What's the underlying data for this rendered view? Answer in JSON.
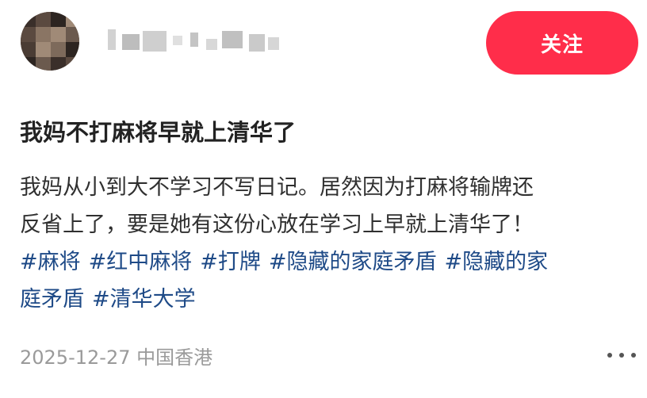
{
  "header": {
    "avatar_colors": [
      "#3a2f2a",
      "#5b4a40",
      "#8a7564",
      "#2d2521",
      "#6b5a4e",
      "#a08a77",
      "#4a3c34",
      "#7d6a5b"
    ],
    "follow_label": "关注",
    "follow_color": "#ff2d4a"
  },
  "post": {
    "title": "我妈不打麻将早就上清华了",
    "body_lines": [
      "我妈从小到大不学习不写日记。居然因为打麻将输牌还",
      "反省上了，要是她有这份心放在学习上早就上清华了！"
    ],
    "tags_line1": [
      "#麻将",
      "#红中麻将",
      "#打牌",
      "#隐藏的家庭矛盾",
      "#隐藏的家"
    ],
    "tags_line2": [
      "庭矛盾",
      "#清华大学"
    ],
    "tag_color": "#1e4a87"
  },
  "footer": {
    "date_location": "2025-12-27 中国香港",
    "more_icon": "more-dots-icon"
  }
}
